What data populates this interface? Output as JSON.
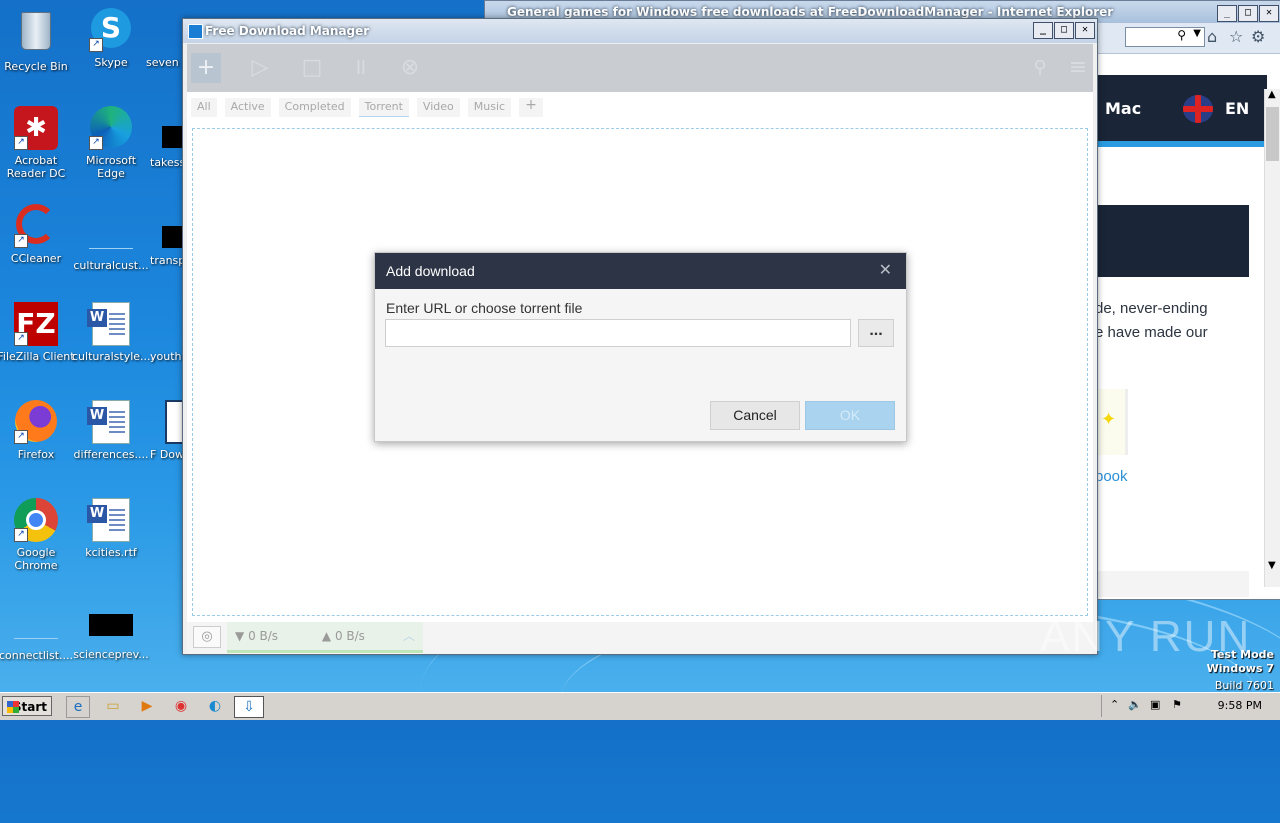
{
  "desktop": {
    "icons": [
      {
        "label": "Recycle Bin"
      },
      {
        "label": "Skype"
      },
      {
        "label": "seven"
      },
      {
        "label": "Acrobat Reader DC"
      },
      {
        "label": "Microsoft Edge"
      },
      {
        "label": "takess"
      },
      {
        "label": "CCleaner"
      },
      {
        "label": "culturalcust..."
      },
      {
        "label": "transp"
      },
      {
        "label": "FileZilla Client"
      },
      {
        "label": "culturalstyle...."
      },
      {
        "label": "youth"
      },
      {
        "label": "Firefox"
      },
      {
        "label": "differences...."
      },
      {
        "label": "F Dow"
      },
      {
        "label": "Google Chrome"
      },
      {
        "label": "kcities.rtf"
      },
      {
        "label": "connectlist...."
      },
      {
        "label": "scienceprev..."
      }
    ]
  },
  "ie_window": {
    "title": "General games for Windows free downloads at FreeDownloadManager - Internet Explorer",
    "nav_mac": "Mac",
    "nav_lang": "EN",
    "text_line1": "de, never-ending",
    "text_line2": "e have made our",
    "link_text": "book"
  },
  "fdm_window": {
    "title": "Free Download Manager",
    "tabs": [
      "All",
      "Active",
      "Completed",
      "Torrent",
      "Video",
      "Music"
    ],
    "add_tab": "+",
    "status": {
      "download_speed": "0 B/s",
      "upload_speed": "0 B/s"
    }
  },
  "dialog": {
    "title": "Add download",
    "label": "Enter URL or choose torrent file",
    "url_value": "",
    "url_placeholder": "",
    "browse_label": "...",
    "cancel_label": "Cancel",
    "ok_label": "OK"
  },
  "taskbar": {
    "start_label": "Start",
    "clock": "9:58 PM"
  },
  "watermark": {
    "brand": "ANY RUN",
    "line1": "Test Mode",
    "line2": "Windows 7",
    "line3": "Build 7601"
  }
}
